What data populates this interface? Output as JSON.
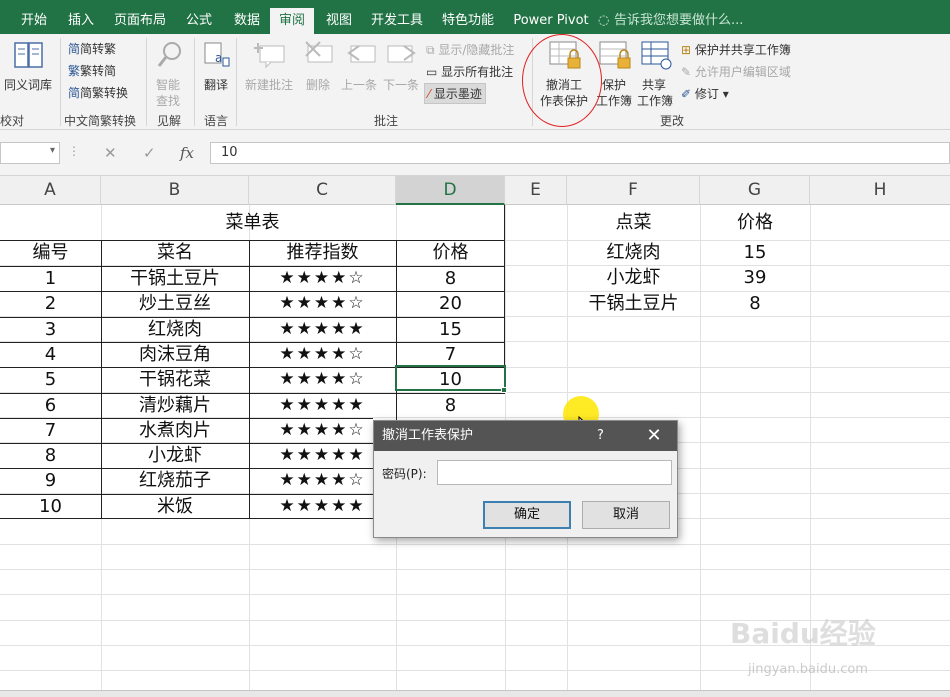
{
  "menu": {
    "tabs": [
      "开始",
      "插入",
      "页面布局",
      "公式",
      "数据",
      "审阅",
      "视图",
      "开发工具",
      "特色功能",
      "Power Pivot"
    ],
    "active_tab": "审阅",
    "tell_me": "告诉我您想要做什么..."
  },
  "ribbon": {
    "proofing": {
      "thesaurus": "同义词库",
      "label": "校对"
    },
    "chinese": {
      "to_trad": "简转繁",
      "to_simp": "繁转简",
      "convert": "简繁转换",
      "label": "中文简繁转换"
    },
    "insights": {
      "smart_lookup_1": "智能",
      "smart_lookup_2": "查找",
      "label": "见解"
    },
    "language": {
      "translate": "翻译",
      "label": "语言"
    },
    "comments": {
      "new": "新建批注",
      "delete": "删除",
      "prev": "上一条",
      "next": "下一条",
      "show_hide": "显示/隐藏批注",
      "show_all": "显示所有批注",
      "show_ink": "显示墨迹",
      "label": "批注"
    },
    "changes": {
      "unprotect_sheet_1": "撤消工",
      "unprotect_sheet_2": "作表保护",
      "protect_wb_1": "保护",
      "protect_wb_2": "工作簿",
      "share_wb_1": "共享",
      "share_wb_2": "工作簿",
      "protect_share": "保护并共享工作簿",
      "allow_edit": "允许用户编辑区域",
      "track": "修订",
      "label": "更改"
    }
  },
  "formula_bar": {
    "value": "10",
    "fx": "fx"
  },
  "columns": [
    "A",
    "B",
    "C",
    "D",
    "E",
    "F",
    "G",
    "H"
  ],
  "table": {
    "title": "菜单表",
    "headers": [
      "编号",
      "菜名",
      "推荐指数",
      "价格"
    ],
    "rows": [
      [
        "1",
        "干锅土豆片",
        "★★★★☆",
        "8"
      ],
      [
        "2",
        "炒土豆丝",
        "★★★★☆",
        "20"
      ],
      [
        "3",
        "红烧肉",
        "★★★★★",
        "15"
      ],
      [
        "4",
        "肉沫豆角",
        "★★★★☆",
        "7"
      ],
      [
        "5",
        "干锅花菜",
        "★★★★☆",
        "10"
      ],
      [
        "6",
        "清炒藕片",
        "★★★★★",
        "8"
      ],
      [
        "7",
        "水煮肉片",
        "★★★★☆",
        ""
      ],
      [
        "8",
        "小龙虾",
        "★★★★★",
        ""
      ],
      [
        "9",
        "红烧茄子",
        "★★★★☆",
        ""
      ],
      [
        "10",
        "米饭",
        "★★★★★",
        ""
      ]
    ]
  },
  "order": {
    "headers": [
      "点菜",
      "价格"
    ],
    "rows": [
      [
        "红烧肉",
        "15"
      ],
      [
        "小龙虾",
        "39"
      ],
      [
        "干锅土豆片",
        "8"
      ]
    ]
  },
  "dialog": {
    "title": "撤消工作表保护",
    "help": "?",
    "close": "✕",
    "password_label": "密码(P):",
    "password_value": "",
    "ok": "确定",
    "cancel": "取消"
  },
  "watermark": {
    "brand": "Baidu经验",
    "url": "jingyan.baidu.com"
  }
}
